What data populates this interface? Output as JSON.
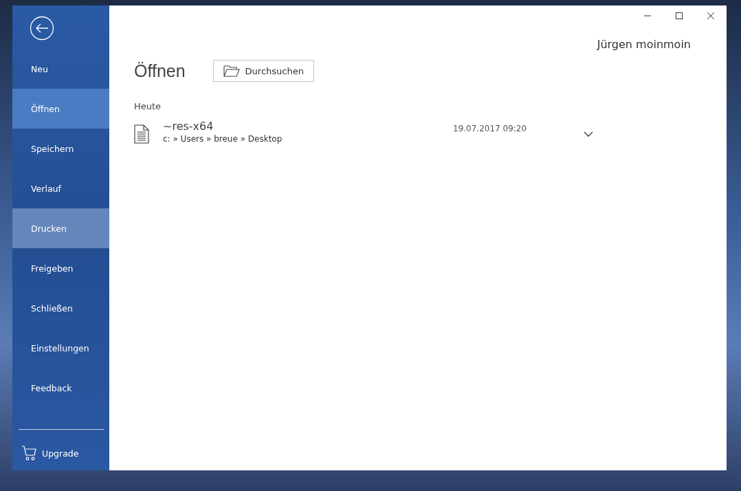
{
  "sidebar": {
    "items": [
      {
        "label": "Neu",
        "selected": false,
        "hovered": false
      },
      {
        "label": "Öffnen",
        "selected": true,
        "hovered": false
      },
      {
        "label": "Speichern",
        "selected": false,
        "hovered": false
      },
      {
        "label": "Verlauf",
        "selected": false,
        "hovered": false
      },
      {
        "label": "Drucken",
        "selected": false,
        "hovered": true
      },
      {
        "label": "Freigeben",
        "selected": false,
        "hovered": false
      },
      {
        "label": "Schließen",
        "selected": false,
        "hovered": false
      },
      {
        "label": "Einstellungen",
        "selected": false,
        "hovered": false
      },
      {
        "label": "Feedback",
        "selected": false,
        "hovered": false
      }
    ],
    "upgrade": "Upgrade"
  },
  "user": "Jürgen moinmoin",
  "page": {
    "title": "Öffnen",
    "browse_button": "Durchsuchen"
  },
  "groups": [
    {
      "heading": "Heute",
      "files": [
        {
          "name": "~res-x64",
          "path": "c: » Users » breue » Desktop",
          "modified": "19.07.2017 09:20"
        }
      ]
    }
  ]
}
